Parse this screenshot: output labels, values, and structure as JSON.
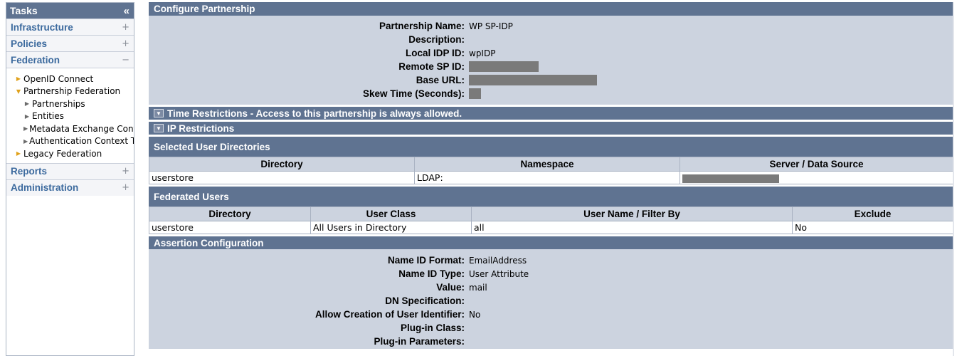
{
  "sidebar": {
    "title": "Tasks",
    "collapse_icon": "«",
    "sections_top": [
      {
        "label": "Infrastructure",
        "icon": "+"
      },
      {
        "label": "Policies",
        "icon": "+"
      },
      {
        "label": "Federation",
        "icon": "−"
      }
    ],
    "tree": [
      {
        "label": "OpenID Connect"
      },
      {
        "label": "Partnership Federation"
      },
      {
        "label": "Partnerships"
      },
      {
        "label": "Entities"
      },
      {
        "label": "Metadata Exchange Configu"
      },
      {
        "label": "Authentication Context Tem"
      },
      {
        "label": "Legacy Federation"
      }
    ],
    "sections_bottom": [
      {
        "label": "Reports",
        "icon": "+"
      },
      {
        "label": "Administration",
        "icon": "+"
      }
    ]
  },
  "configure": {
    "title": "Configure Partnership",
    "fields": [
      {
        "label": "Partnership Name:",
        "value": "WP SP-IDP"
      },
      {
        "label": "Description:",
        "value": ""
      },
      {
        "label": "Local IDP ID:",
        "value": "wpIDP"
      },
      {
        "label": "Remote SP ID:",
        "value": ""
      },
      {
        "label": "Base URL:",
        "value": ""
      },
      {
        "label": "Skew Time (Seconds):",
        "value": ""
      }
    ]
  },
  "time_restrictions": {
    "title": "Time Restrictions - Access to this partnership is always allowed."
  },
  "ip_restrictions": {
    "title": "IP Restrictions"
  },
  "user_directories": {
    "title": "Selected User Directories",
    "columns": [
      "Directory",
      "Namespace",
      "Server / Data Source"
    ],
    "rows": [
      [
        "userstore",
        "LDAP:",
        ""
      ]
    ]
  },
  "federated_users": {
    "title": "Federated Users",
    "columns": [
      "Directory",
      "User Class",
      "User Name / Filter By",
      "Exclude"
    ],
    "rows": [
      [
        "userstore",
        "All Users in Directory",
        "all",
        "No"
      ]
    ]
  },
  "assertion": {
    "title": "Assertion Configuration",
    "fields": [
      {
        "label": "Name ID Format:",
        "value": "EmailAddress"
      },
      {
        "label": "Name ID Type:",
        "value": "User Attribute"
      },
      {
        "label": "Value:",
        "value": "mail"
      },
      {
        "label": "DN Specification:",
        "value": ""
      },
      {
        "label": "Allow Creation of User Identifier:",
        "value": "No"
      },
      {
        "label": "Plug-in Class:",
        "value": ""
      },
      {
        "label": "Plug-in Parameters:",
        "value": ""
      }
    ]
  },
  "colors": {
    "header_bar": "#5f7391",
    "panel": "#ccd3df",
    "nav_link": "#3c6a9e",
    "redaction": "#7a7a7a"
  }
}
